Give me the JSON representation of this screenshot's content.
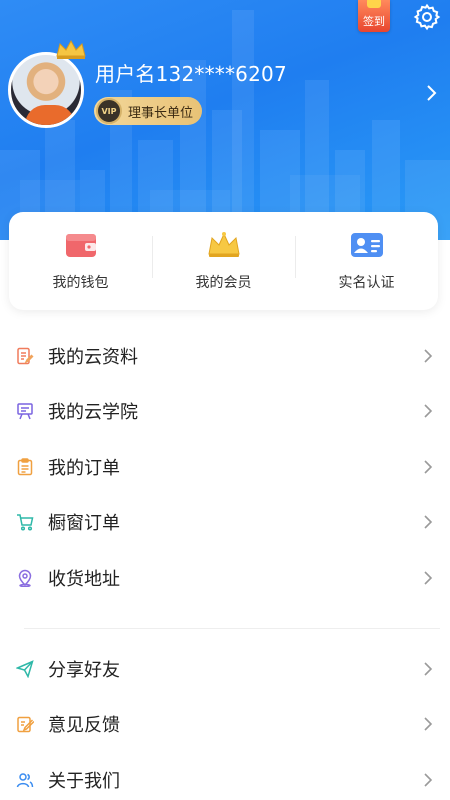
{
  "header": {
    "sign_label": "签到",
    "username": "用户名132****6207",
    "badge_icon_text": "VIP",
    "badge_label": "理事长单位"
  },
  "quick_actions": [
    {
      "label": "我的钱包",
      "icon": "wallet-icon"
    },
    {
      "label": "我的会员",
      "icon": "crown-icon"
    },
    {
      "label": "实名认证",
      "icon": "id-card-icon"
    }
  ],
  "menu": [
    {
      "label": "我的云资料",
      "icon": "document-edit-icon"
    },
    {
      "label": "我的云学院",
      "icon": "presentation-board-icon"
    },
    {
      "label": "我的订单",
      "icon": "clipboard-icon"
    },
    {
      "label": "橱窗订单",
      "icon": "shopping-cart-icon"
    },
    {
      "label": "收货地址",
      "icon": "location-pin-icon"
    }
  ],
  "menu_secondary": [
    {
      "label": "分享好友",
      "icon": "paper-plane-icon"
    },
    {
      "label": "意见反馈",
      "icon": "feedback-edit-icon"
    },
    {
      "label": "关于我们",
      "icon": "people-icon"
    }
  ],
  "colors": {
    "header_blue": "#1f7ef0",
    "badge_gold": "#e8c276",
    "sign_red": "#e8452f"
  }
}
